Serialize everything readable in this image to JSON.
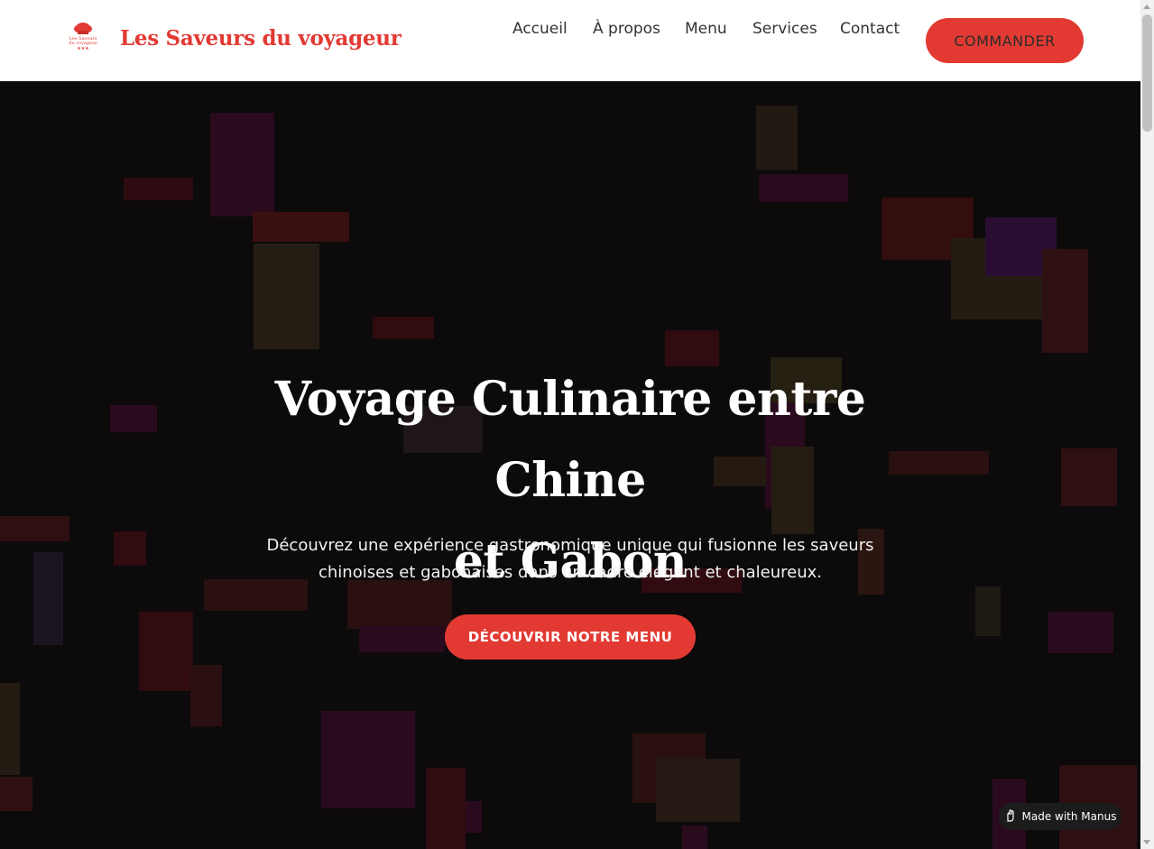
{
  "header": {
    "brand": "Les Saveurs du voyageur",
    "logo_text": "Les Saveurs du voyageur",
    "nav": [
      "Accueil",
      "À propos",
      "Menu",
      "Services",
      "Contact"
    ],
    "order_button": "COMMANDER"
  },
  "hero": {
    "title_line1": "Voyage Culinaire entre Chine",
    "title_line2": "et Gabon",
    "subtitle_line1": "Découvrez une expérience gastronomique unique qui fusionne les saveurs",
    "subtitle_line2": "chinoises et gabonaises dans un cadre élégant et chaleureux.",
    "cta": "DÉCOUVRIR NOTRE MENU"
  },
  "badge": {
    "label": "Made with Manus",
    "icon": "manus-hand-icon"
  },
  "colors": {
    "accent": "#e23a33",
    "hero_bg": "#0c0a0b",
    "header_bg": "#ffffff"
  }
}
